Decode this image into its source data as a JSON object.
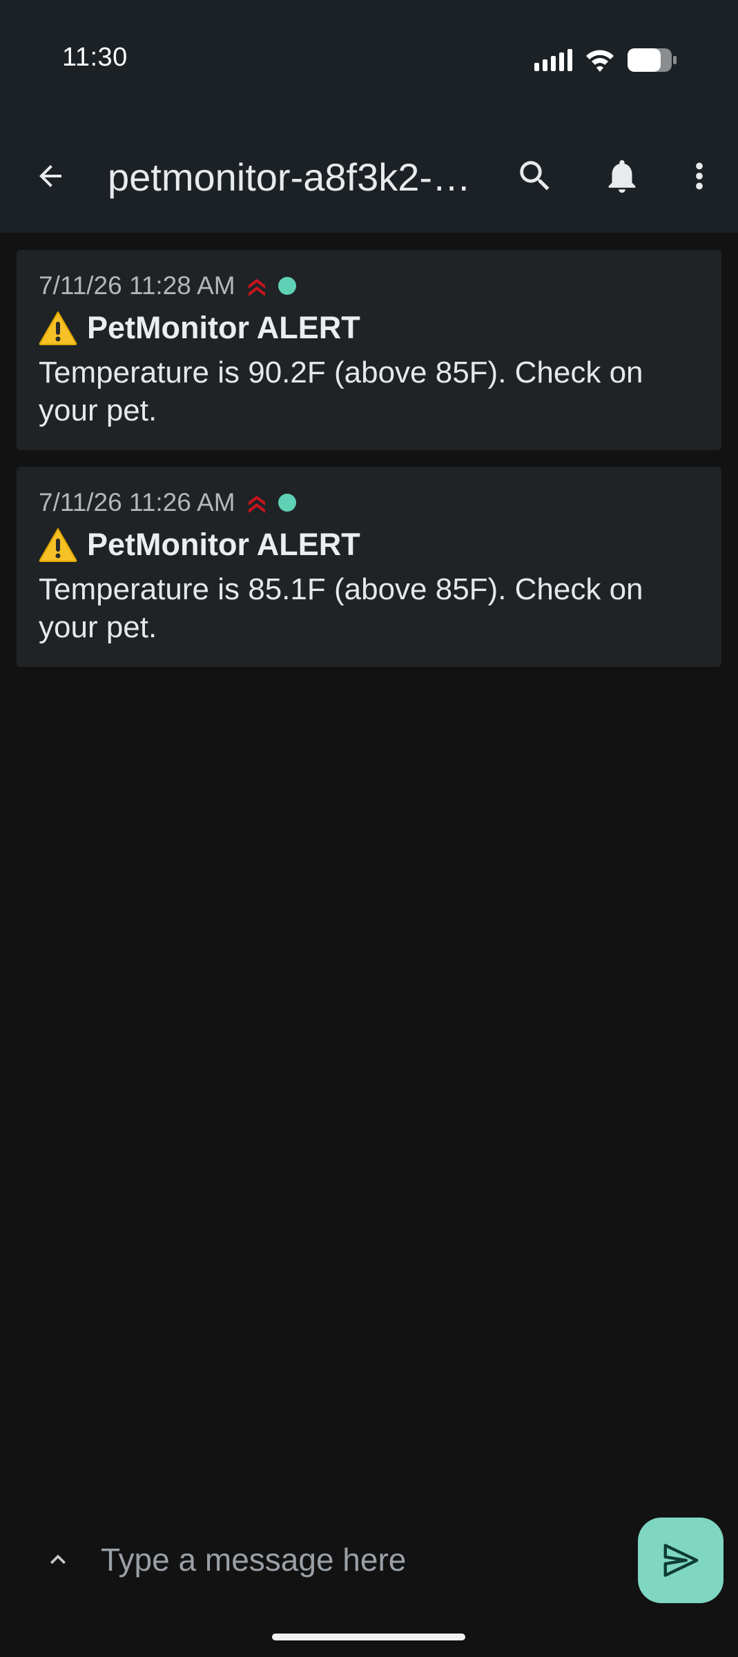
{
  "status_bar": {
    "time": "11:30",
    "icons": [
      "signal-icon",
      "wifi-icon",
      "battery-icon"
    ]
  },
  "app_bar": {
    "title": "petmonitor-a8f3k2-…",
    "icons": [
      "back-arrow-icon",
      "search-icon",
      "bell-icon",
      "more-vert-icon"
    ]
  },
  "notifications": [
    {
      "time": "7/11/26 11:28 AM",
      "title": "PetMonitor ALERT",
      "body": "Temperature is 90.2F (above 85F). Check on your pet."
    },
    {
      "time": "7/11/26 11:26 AM",
      "title": "PetMonitor ALERT",
      "body": "Temperature is 85.1F (above 85F). Check on your pet."
    }
  ],
  "composer": {
    "placeholder": "Type a message here"
  },
  "colors": {
    "background": "#121212",
    "top_bar": "#1c2125",
    "card": "#1f2326",
    "accent": "#7fd6c1",
    "priority_high": "#c8141e",
    "status_dot": "#5fd1b5"
  }
}
